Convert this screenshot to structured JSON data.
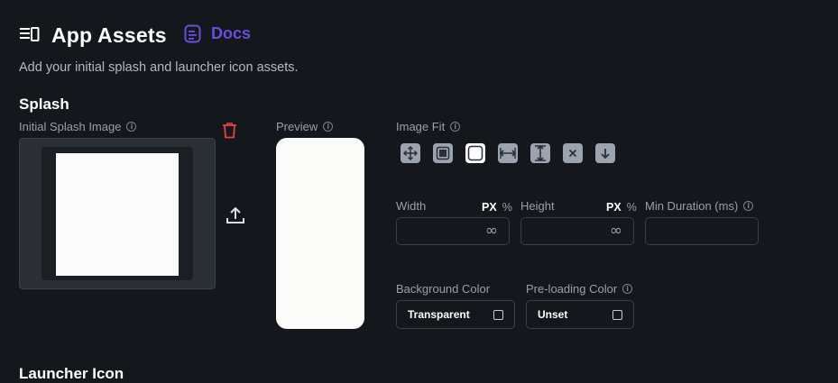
{
  "header": {
    "title": "App Assets",
    "docs_label": "Docs",
    "subtitle": "Add your initial splash and launcher icon assets."
  },
  "splash": {
    "section_title": "Splash",
    "image_label": "Initial Splash Image",
    "preview_label": "Preview",
    "image_fit_label": "Image Fit",
    "width_label": "Width",
    "height_label": "Height",
    "unit_px": "PX",
    "unit_percent": "%",
    "width_value": "∞",
    "height_value": "∞",
    "min_duration_label": "Min Duration (ms)",
    "min_duration_value": "",
    "background_color_label": "Background Color",
    "background_color_value": "Transparent",
    "preloading_color_label": "Pre-loading Color",
    "preloading_color_value": "Unset"
  },
  "launcher": {
    "section_title": "Launcher Icon"
  },
  "colors": {
    "background": "#14171b",
    "accent": "#6c4ce0",
    "danger": "#e0463f"
  }
}
